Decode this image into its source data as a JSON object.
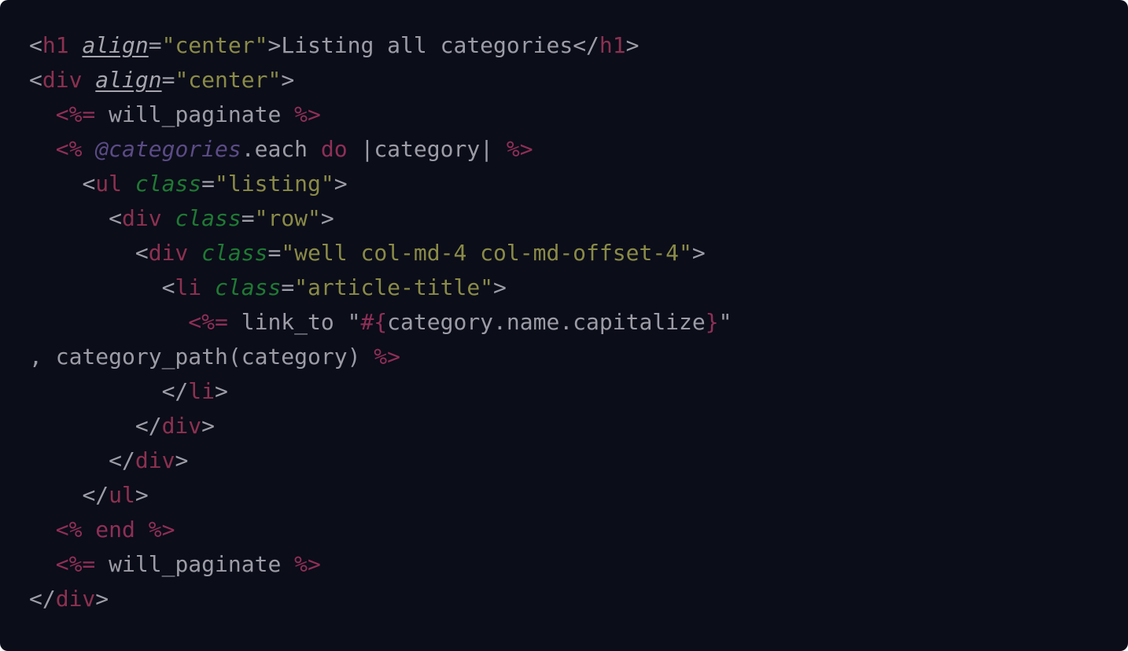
{
  "colors": {
    "background": "#0b0d19",
    "tag": "#8c3150",
    "erb": "#8f2f56",
    "string": "#8a8b47",
    "class_attr": "#1f7a33",
    "instance_var": "#5b4b86",
    "plain": "#9c9ca6"
  },
  "code": {
    "lines": [
      [
        {
          "cls": "t-punct",
          "text": "<"
        },
        {
          "cls": "t-tag",
          "text": "h1"
        },
        {
          "cls": "t-plain",
          "text": " "
        },
        {
          "cls": "t-attr-italic",
          "text": "align"
        },
        {
          "cls": "t-eq",
          "text": "="
        },
        {
          "cls": "t-str",
          "text": "\"center\""
        },
        {
          "cls": "t-punct",
          "text": ">"
        },
        {
          "cls": "t-plain",
          "text": "Listing all categories"
        },
        {
          "cls": "t-punct",
          "text": "</"
        },
        {
          "cls": "t-tag",
          "text": "h1"
        },
        {
          "cls": "t-punct",
          "text": ">"
        }
      ],
      [
        {
          "cls": "t-punct",
          "text": "<"
        },
        {
          "cls": "t-tag",
          "text": "div"
        },
        {
          "cls": "t-plain",
          "text": " "
        },
        {
          "cls": "t-attr-italic",
          "text": "align"
        },
        {
          "cls": "t-eq",
          "text": "="
        },
        {
          "cls": "t-str",
          "text": "\"center\""
        },
        {
          "cls": "t-punct",
          "text": ">"
        }
      ],
      [
        {
          "cls": "t-plain",
          "text": "  "
        },
        {
          "cls": "t-erb",
          "text": "<%="
        },
        {
          "cls": "t-plain",
          "text": " will_paginate "
        },
        {
          "cls": "t-erb",
          "text": "%>"
        }
      ],
      [
        {
          "cls": "t-plain",
          "text": "  "
        },
        {
          "cls": "t-erb",
          "text": "<%"
        },
        {
          "cls": "t-plain",
          "text": " "
        },
        {
          "cls": "t-ivar",
          "text": "@categories"
        },
        {
          "cls": "t-plain",
          "text": ".each "
        },
        {
          "cls": "t-keyword",
          "text": "do"
        },
        {
          "cls": "t-plain",
          "text": " |category| "
        },
        {
          "cls": "t-erb",
          "text": "%>"
        }
      ],
      [
        {
          "cls": "t-plain",
          "text": "    "
        },
        {
          "cls": "t-punct",
          "text": "<"
        },
        {
          "cls": "t-tag",
          "text": "ul"
        },
        {
          "cls": "t-plain",
          "text": " "
        },
        {
          "cls": "t-attr-class",
          "text": "class"
        },
        {
          "cls": "t-eq",
          "text": "="
        },
        {
          "cls": "t-str",
          "text": "\"listing\""
        },
        {
          "cls": "t-punct",
          "text": ">"
        }
      ],
      [
        {
          "cls": "t-plain",
          "text": "      "
        },
        {
          "cls": "t-punct",
          "text": "<"
        },
        {
          "cls": "t-tag",
          "text": "div"
        },
        {
          "cls": "t-plain",
          "text": " "
        },
        {
          "cls": "t-attr-class",
          "text": "class"
        },
        {
          "cls": "t-eq",
          "text": "="
        },
        {
          "cls": "t-str",
          "text": "\"row\""
        },
        {
          "cls": "t-punct",
          "text": ">"
        }
      ],
      [
        {
          "cls": "t-plain",
          "text": "        "
        },
        {
          "cls": "t-punct",
          "text": "<"
        },
        {
          "cls": "t-tag",
          "text": "div"
        },
        {
          "cls": "t-plain",
          "text": " "
        },
        {
          "cls": "t-attr-class",
          "text": "class"
        },
        {
          "cls": "t-eq",
          "text": "="
        },
        {
          "cls": "t-str",
          "text": "\"well col-md-4 col-md-offset-4\""
        },
        {
          "cls": "t-punct",
          "text": ">"
        }
      ],
      [
        {
          "cls": "t-plain",
          "text": "          "
        },
        {
          "cls": "t-punct",
          "text": "<"
        },
        {
          "cls": "t-tag",
          "text": "li"
        },
        {
          "cls": "t-plain",
          "text": " "
        },
        {
          "cls": "t-attr-class",
          "text": "class"
        },
        {
          "cls": "t-eq",
          "text": "="
        },
        {
          "cls": "t-str",
          "text": "\"article-title\""
        },
        {
          "cls": "t-punct",
          "text": ">"
        }
      ],
      [
        {
          "cls": "t-plain",
          "text": "            "
        },
        {
          "cls": "t-erb",
          "text": "<%="
        },
        {
          "cls": "t-plain",
          "text": " link_to \""
        },
        {
          "cls": "t-erb",
          "text": "#{"
        },
        {
          "cls": "t-plain",
          "text": "category.name.capitalize"
        },
        {
          "cls": "t-erb",
          "text": "}"
        },
        {
          "cls": "t-plain",
          "text": "\""
        }
      ],
      [
        {
          "cls": "t-plain",
          "text": ", category_path(category) "
        },
        {
          "cls": "t-erb",
          "text": "%>"
        }
      ],
      [
        {
          "cls": "t-plain",
          "text": "          "
        },
        {
          "cls": "t-punct",
          "text": "</"
        },
        {
          "cls": "t-tag",
          "text": "li"
        },
        {
          "cls": "t-punct",
          "text": ">"
        }
      ],
      [
        {
          "cls": "t-plain",
          "text": "        "
        },
        {
          "cls": "t-punct",
          "text": "</"
        },
        {
          "cls": "t-tag",
          "text": "div"
        },
        {
          "cls": "t-punct",
          "text": ">"
        }
      ],
      [
        {
          "cls": "t-plain",
          "text": "      "
        },
        {
          "cls": "t-punct",
          "text": "</"
        },
        {
          "cls": "t-tag",
          "text": "div"
        },
        {
          "cls": "t-punct",
          "text": ">"
        }
      ],
      [
        {
          "cls": "t-plain",
          "text": "    "
        },
        {
          "cls": "t-punct",
          "text": "</"
        },
        {
          "cls": "t-tag",
          "text": "ul"
        },
        {
          "cls": "t-punct",
          "text": ">"
        }
      ],
      [
        {
          "cls": "t-plain",
          "text": "  "
        },
        {
          "cls": "t-erb",
          "text": "<%"
        },
        {
          "cls": "t-plain",
          "text": " "
        },
        {
          "cls": "t-keyword",
          "text": "end"
        },
        {
          "cls": "t-plain",
          "text": " "
        },
        {
          "cls": "t-erb",
          "text": "%>"
        }
      ],
      [
        {
          "cls": "t-plain",
          "text": "  "
        },
        {
          "cls": "t-erb",
          "text": "<%="
        },
        {
          "cls": "t-plain",
          "text": " will_paginate "
        },
        {
          "cls": "t-erb",
          "text": "%>"
        }
      ],
      [
        {
          "cls": "t-punct",
          "text": "</"
        },
        {
          "cls": "t-tag",
          "text": "div"
        },
        {
          "cls": "t-punct",
          "text": ">"
        }
      ]
    ]
  }
}
